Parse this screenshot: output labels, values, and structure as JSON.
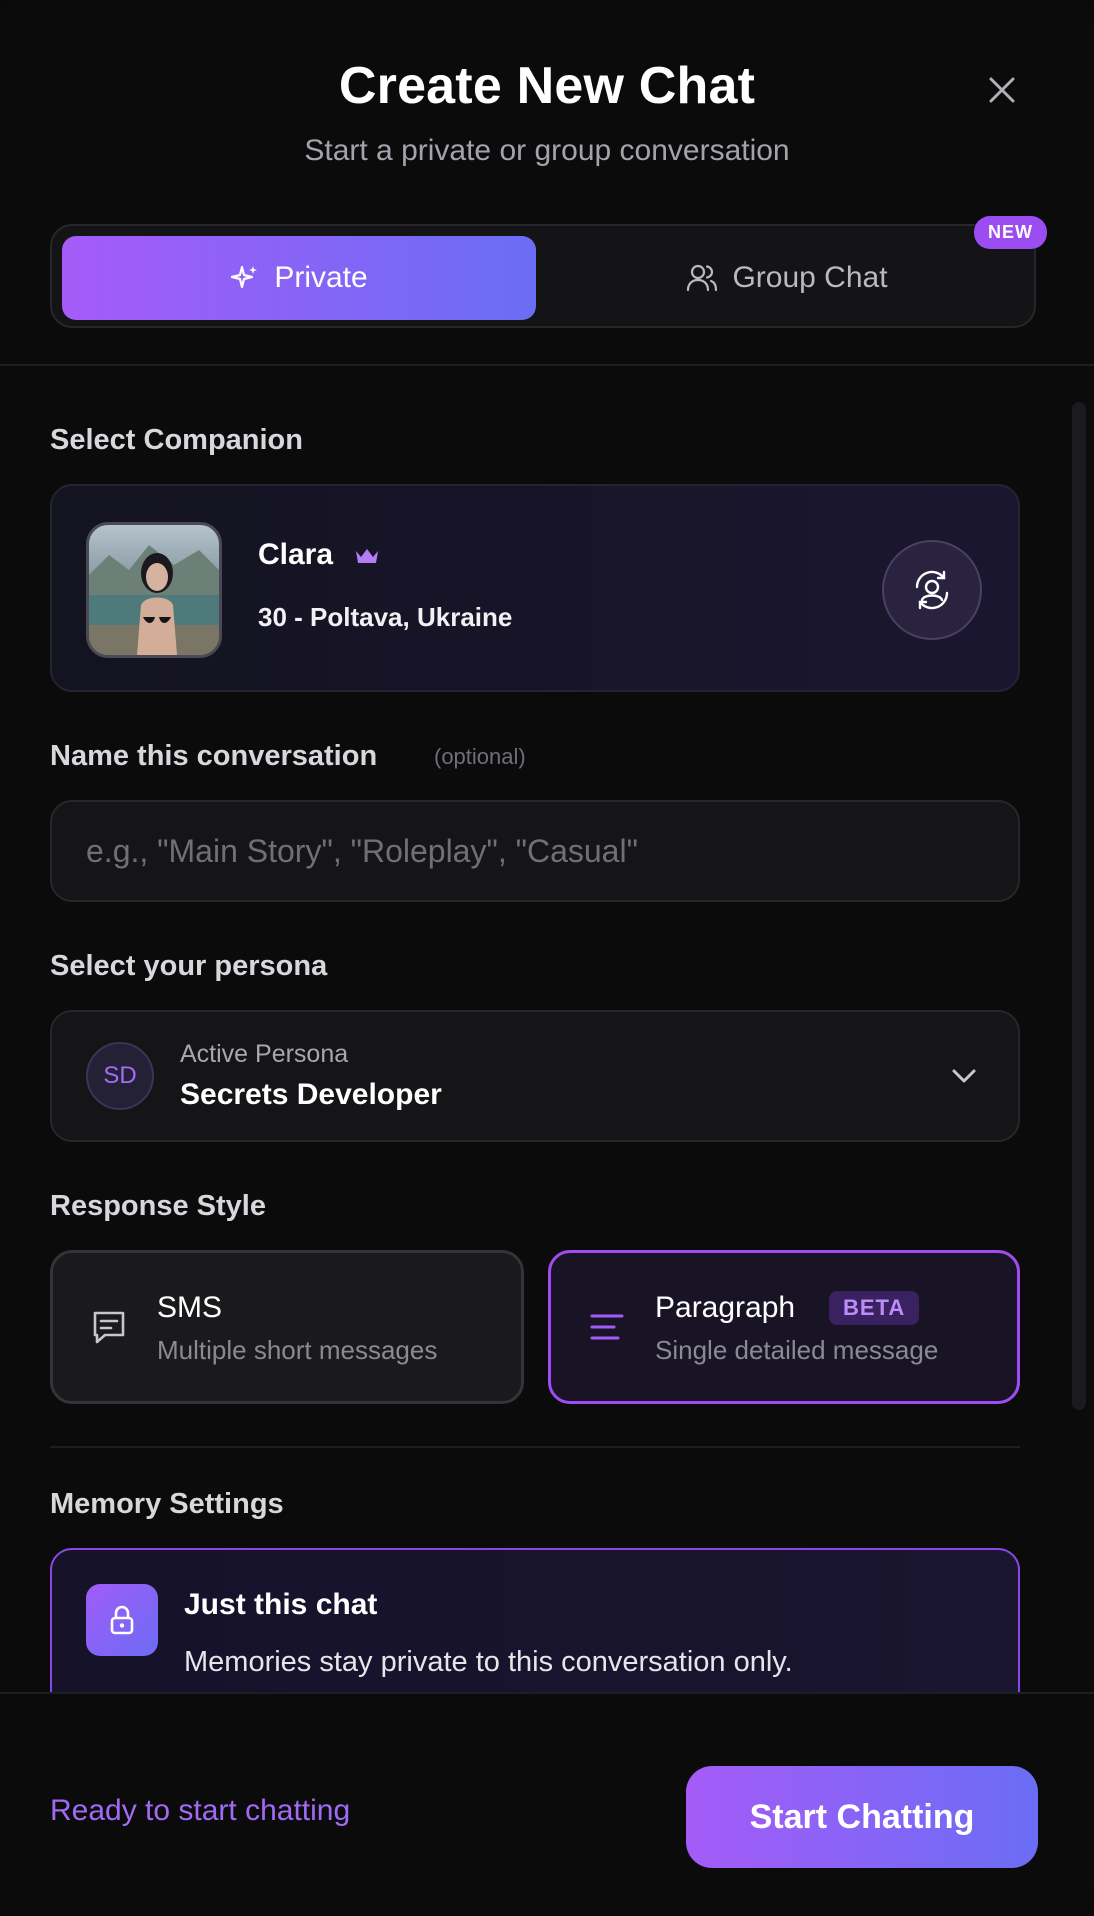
{
  "header": {
    "title": "Create New Chat",
    "subtitle": "Start a private or group conversation"
  },
  "tabs": [
    {
      "label": "Private",
      "active": true,
      "icon": "sparkles-icon"
    },
    {
      "label": "Group Chat",
      "active": false,
      "icon": "users-icon"
    }
  ],
  "badges": {
    "new": "NEW",
    "beta": "BETA"
  },
  "companion": {
    "section_label": "Select Companion",
    "name": "Clara",
    "meta": "30 - Poltava, Ukraine",
    "tier_icon": "crown-icon"
  },
  "conversation_name": {
    "label": "Name this conversation",
    "optional": "(optional)",
    "placeholder": "e.g., \"Main Story\", \"Roleplay\", \"Casual\"",
    "value": ""
  },
  "persona": {
    "label": "Select your persona",
    "initials": "SD",
    "caption": "Active Persona",
    "name": "Secrets Developer"
  },
  "response_style": {
    "label": "Response Style",
    "options": [
      {
        "title": "SMS",
        "desc": "Multiple short messages",
        "selected": false,
        "icon": "message-icon"
      },
      {
        "title": "Paragraph",
        "desc": "Single detailed message",
        "selected": true,
        "icon": "paragraph-icon"
      }
    ]
  },
  "memory": {
    "label": "Memory Settings",
    "title": "Just this chat",
    "desc": "Memories stay private to this conversation only."
  },
  "footer": {
    "status": "Ready to start chatting",
    "start_label": "Start Chatting"
  },
  "colors": {
    "accent_start": "#a55bf7",
    "accent_end": "#6a6df5",
    "selected_border": "#9f4df2",
    "background": "#0b0b0c"
  }
}
